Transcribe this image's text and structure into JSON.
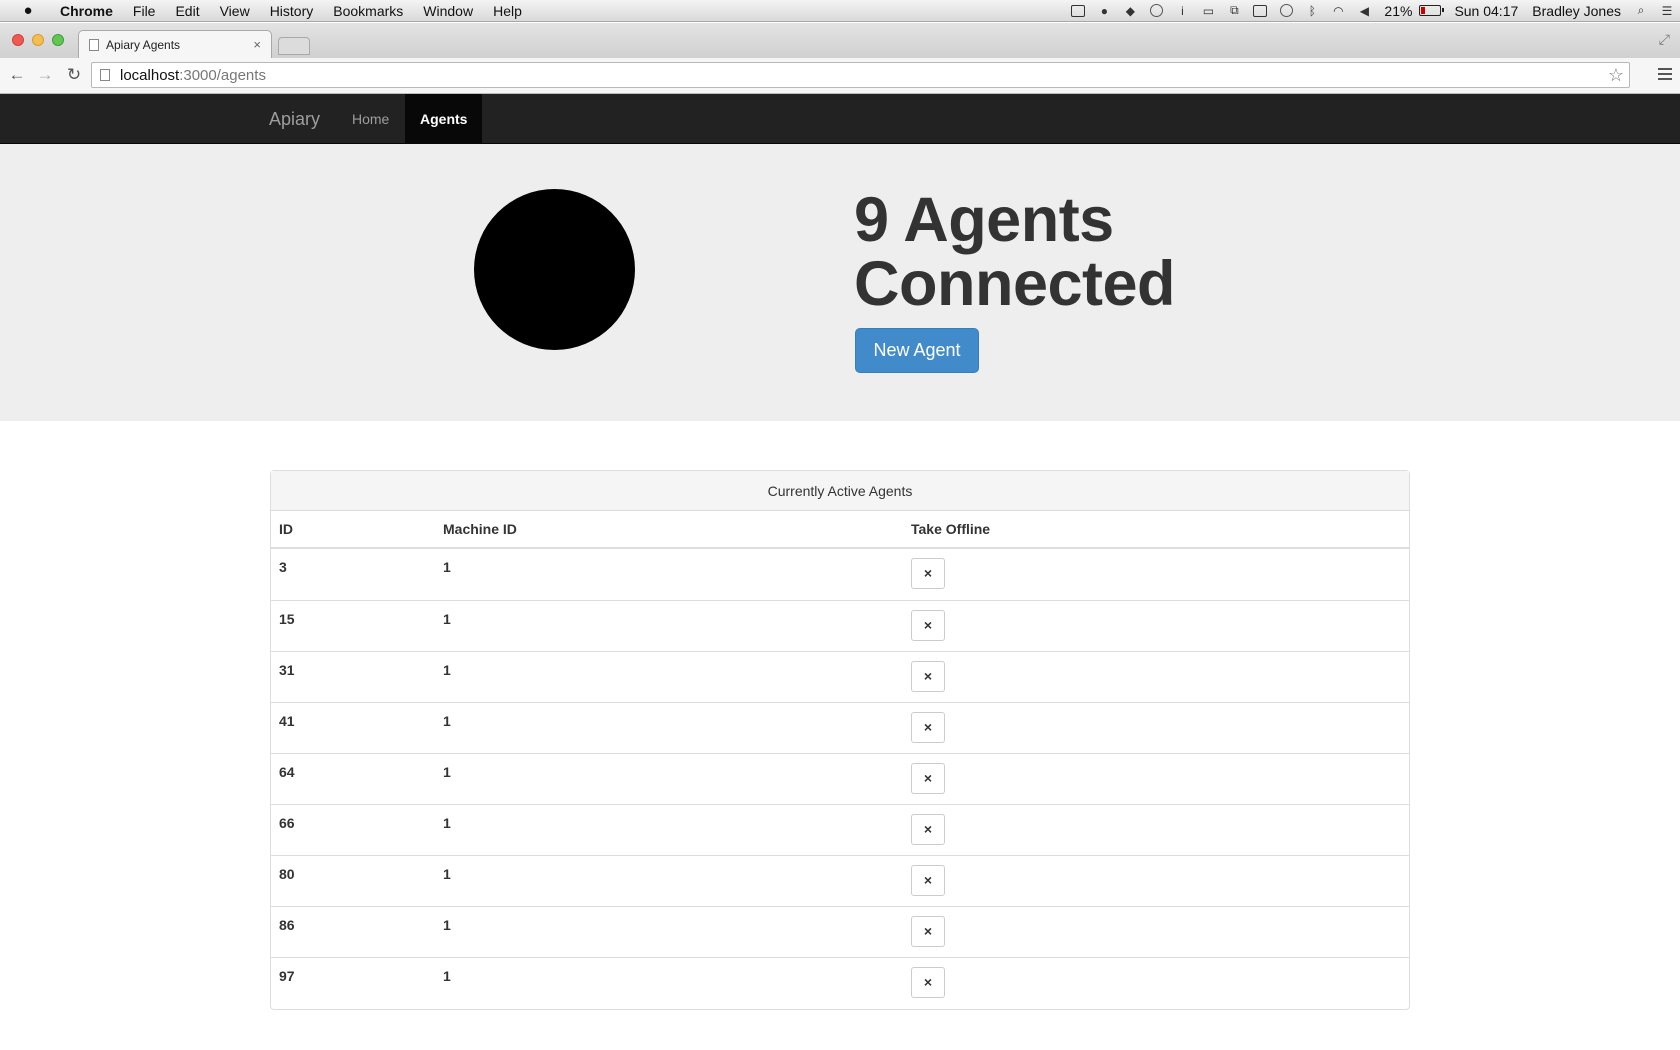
{
  "os": {
    "menus": [
      "Chrome",
      "File",
      "Edit",
      "View",
      "History",
      "Bookmarks",
      "Window",
      "Help"
    ],
    "battery_percent": "21%",
    "clock": "Sun 04:17",
    "user": "Bradley Jones"
  },
  "browser": {
    "tab_title": "Apiary Agents",
    "url_host": "localhost",
    "url_path": ":3000/agents"
  },
  "navbar": {
    "brand": "Apiary",
    "links": [
      "Home",
      "Agents"
    ]
  },
  "hero": {
    "title_line1": "9 Agents",
    "title_line2": "Connected",
    "button": "New Agent"
  },
  "table": {
    "heading": "Currently Active Agents",
    "columns": [
      "ID",
      "Machine ID",
      "Take Offline"
    ],
    "action_glyph": "×",
    "rows": [
      {
        "id": "3",
        "machine_id": "1"
      },
      {
        "id": "15",
        "machine_id": "1"
      },
      {
        "id": "31",
        "machine_id": "1"
      },
      {
        "id": "41",
        "machine_id": "1"
      },
      {
        "id": "64",
        "machine_id": "1"
      },
      {
        "id": "66",
        "machine_id": "1"
      },
      {
        "id": "80",
        "machine_id": "1"
      },
      {
        "id": "86",
        "machine_id": "1"
      },
      {
        "id": "97",
        "machine_id": "1"
      }
    ]
  }
}
